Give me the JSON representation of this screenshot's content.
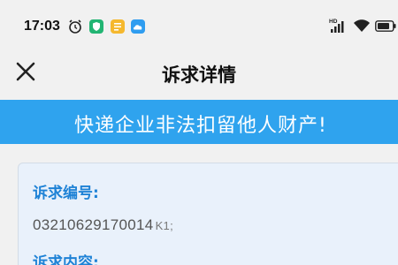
{
  "status_bar": {
    "time": "17:03",
    "icons": [
      "alarm-icon",
      "shield-icon",
      "note-icon",
      "cloud-icon",
      "hd-signal-icon",
      "wifi-icon",
      "battery-icon"
    ],
    "hd_label": "HD"
  },
  "nav": {
    "title": "诉求详情",
    "close_icon": "close-icon"
  },
  "banner": {
    "text": "快递企业非法扣留他人财产!",
    "color": "#2fa3ee"
  },
  "detail": {
    "number_label": "诉求编号:",
    "number_value": "03210629170014",
    "number_suffix": "K1;",
    "content_label": "诉求内容:"
  },
  "colors": {
    "accent": "#1e82d6",
    "banner": "#2fa3ee",
    "card_bg": "#e9f1fb"
  }
}
